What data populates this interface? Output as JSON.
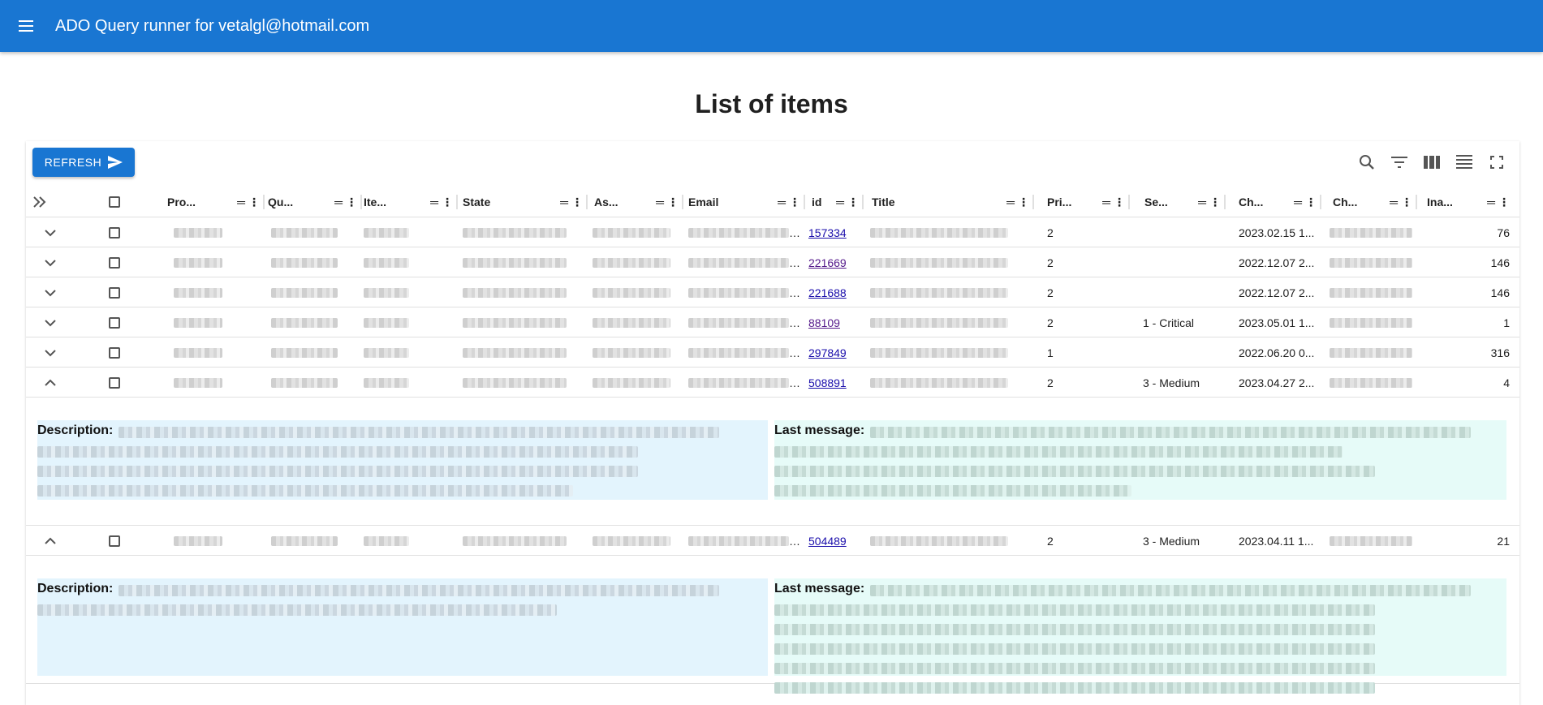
{
  "app": {
    "title": "ADO Query runner for vetalgl@hotmail.com"
  },
  "page": {
    "title": "List of items"
  },
  "toolbar": {
    "refresh_label": "REFRESH",
    "icons": [
      "search-icon",
      "filter-icon",
      "columns-icon",
      "density-icon",
      "fullscreen-icon"
    ]
  },
  "columns": {
    "project": "Pro...",
    "query": "Qu...",
    "item_type": "Ite...",
    "state": "State",
    "assigned": "As...",
    "email": "Email",
    "id": "id",
    "title": "Title",
    "priority": "Pri...",
    "severity": "Se...",
    "changed": "Ch...",
    "changed_by": "Ch...",
    "inactive": "Ina..."
  },
  "rows": [
    {
      "id": "157334",
      "priority": "2",
      "severity": "",
      "changed": "2023.02.15 1...",
      "inactive": "76",
      "expanded": false,
      "visited": false
    },
    {
      "id": "221669",
      "priority": "2",
      "severity": "",
      "changed": "2022.12.07 2...",
      "inactive": "146",
      "expanded": false,
      "visited": true
    },
    {
      "id": "221688",
      "priority": "2",
      "severity": "",
      "changed": "2022.12.07 2...",
      "inactive": "146",
      "expanded": false,
      "visited": false
    },
    {
      "id": "88109",
      "priority": "2",
      "severity": "1 - Critical",
      "changed": "2023.05.01 1...",
      "inactive": "1",
      "expanded": false,
      "visited": true
    },
    {
      "id": "297849",
      "priority": "1",
      "severity": "",
      "changed": "2022.06.20 0...",
      "inactive": "316",
      "expanded": false,
      "visited": false
    },
    {
      "id": "508891",
      "priority": "2",
      "severity": "3 - Medium",
      "changed": "2023.04.27 2...",
      "inactive": "4",
      "expanded": true,
      "visited": false
    },
    {
      "id": "504489",
      "priority": "2",
      "severity": "3 - Medium",
      "changed": "2023.04.11 1...",
      "inactive": "21",
      "expanded": true,
      "visited": false
    }
  ],
  "detail": {
    "description_label": "Description:",
    "last_message_label": "Last message:"
  },
  "colors": {
    "appbar": "#1976d2",
    "description_bg": "#e3f4fd",
    "message_bg": "#e6fbf8"
  }
}
